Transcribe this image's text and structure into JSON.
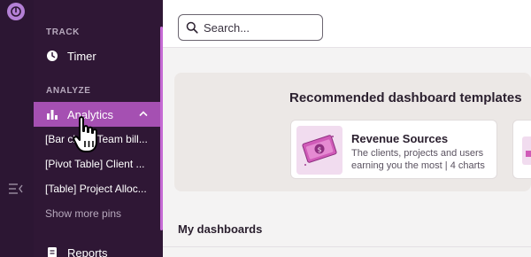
{
  "sidebar": {
    "sections": {
      "track": "TRACK",
      "analyze": "ANALYZE"
    },
    "items": {
      "timer": "Timer",
      "analytics": "Analytics",
      "reports": "Reports"
    },
    "pins": [
      "[Bar chart] Team bill...",
      "[Pivot Table] Client ...",
      "[Table] Project Alloc..."
    ],
    "show_more": "Show more pins"
  },
  "search": {
    "placeholder": "Search..."
  },
  "recommended": {
    "title": "Recommended dashboard templates",
    "cards": [
      {
        "name": "Revenue Sources",
        "description": "The clients, projects and users earning you the most | 4 charts"
      }
    ]
  },
  "my_dashboards": {
    "title": "My dashboards"
  },
  "colors": {
    "sidebar_bg": "#2f1735",
    "active_item": "#a550b2",
    "logo": "#b480d6"
  }
}
